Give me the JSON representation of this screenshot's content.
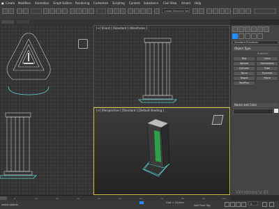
{
  "menubar": {
    "items": [
      "Create",
      "Modifiers",
      "Animation",
      "Graph Editors",
      "Rendering",
      "Customize",
      "Scripting",
      "Content",
      "Substance",
      "Civil View",
      "Arnold",
      "Help"
    ],
    "search_value": "Create Selection Set"
  },
  "viewports": {
    "front_label": "[+] [Front ] [Standard ] [Wireframe ]",
    "perspective_label": "[+] [Perspective ] [Standard ] [Default Shading ]"
  },
  "command_panel": {
    "category_value": "Standard Primitives",
    "object_type_title": "Object Type",
    "autogrid_label": "AutoGrid",
    "object_buttons": [
      "Box",
      "Cone",
      "Sphere",
      "GeoSphere",
      "Cylinder",
      "Tube",
      "Torus",
      "Pyramid",
      "Teapot",
      "Plane",
      "TextPlus"
    ],
    "name_color_title": "Name and Color"
  },
  "timeline": {
    "ticks": [
      "0",
      "10",
      "20",
      "30",
      "40",
      "50",
      "60",
      "70",
      "80",
      "90",
      "100"
    ]
  },
  "statusbar": {
    "select_text": "select objects",
    "grid_text": "Grid = 10,0cm",
    "add_time_tag": "Add Time Tag",
    "frame_value": "0"
  },
  "watermark": "Windows'u Et",
  "colors": {
    "accent": "#1f8fff",
    "highlight": "#d4c243",
    "wire_cyan": "#5fd6d6",
    "model_green": "#2fa04a"
  }
}
